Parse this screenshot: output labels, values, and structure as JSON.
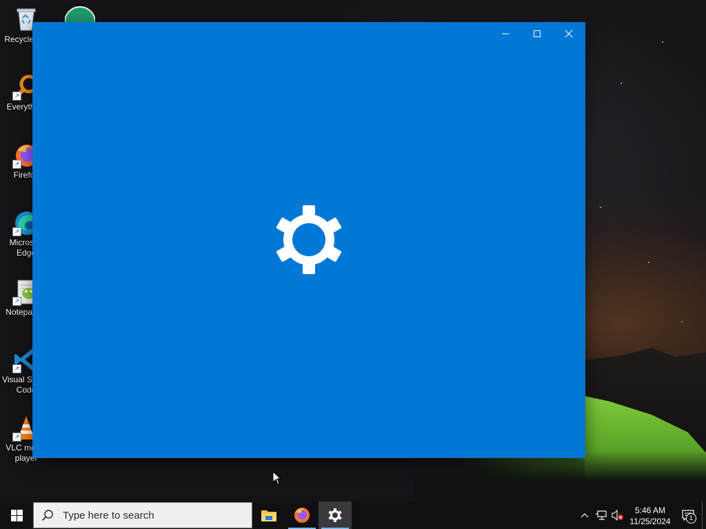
{
  "desktop": {
    "icons": [
      {
        "name": "recycle-bin",
        "label": "Recycle Bin"
      },
      {
        "name": "everything",
        "label": "Everything"
      },
      {
        "name": "firefox",
        "label": "Firefox"
      },
      {
        "name": "microsoft-edge",
        "label": "Microsoft\nEdge"
      },
      {
        "name": "notepad-plus-plus",
        "label": "Notepad++"
      },
      {
        "name": "visual-studio-code",
        "label": "Visual Studio\nCode"
      },
      {
        "name": "vlc-media-player",
        "label": "VLC media\nplayer"
      }
    ]
  },
  "window": {
    "app": "Settings",
    "controls": {
      "minimize_icon": "minimize-icon",
      "maximize_icon": "maximize-icon",
      "close_icon": "close-icon"
    },
    "splash_icon": "gear-icon",
    "background_color": "#0078d7"
  },
  "taskbar": {
    "search": {
      "placeholder": "Type here to search"
    },
    "pinned": [
      {
        "name": "file-explorer",
        "icon": "folder-icon"
      },
      {
        "name": "firefox",
        "icon": "firefox-icon"
      },
      {
        "name": "settings",
        "icon": "gear-icon",
        "active": true
      }
    ],
    "tray": {
      "time": "5:46 AM",
      "date": "11/25/2024",
      "notification_count": "1"
    }
  },
  "colors": {
    "accent": "#0078d7",
    "taskbar": "#101012",
    "running_indicator": "#76b9ed"
  }
}
